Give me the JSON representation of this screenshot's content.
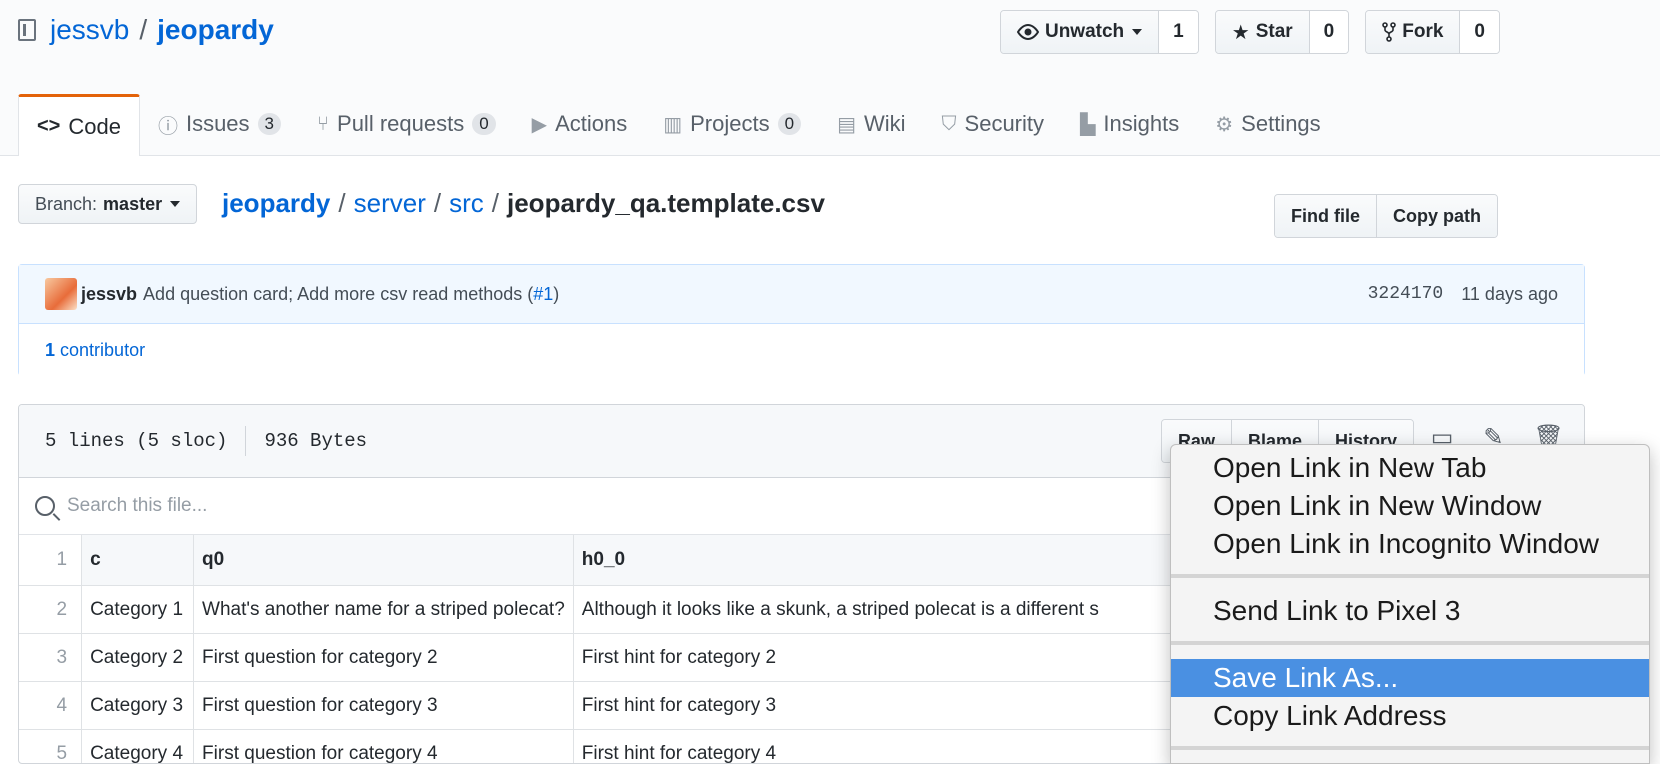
{
  "repo": {
    "owner": "jessvb",
    "separator": "/",
    "name": "jeopardy"
  },
  "actions": {
    "unwatch": {
      "label": "Unwatch",
      "count": "1"
    },
    "star": {
      "label": "Star",
      "count": "0"
    },
    "fork": {
      "label": "Fork",
      "count": "0"
    }
  },
  "tabs": [
    {
      "label": "Code",
      "icon": "<>"
    },
    {
      "label": "Issues",
      "count": "3"
    },
    {
      "label": "Pull requests",
      "count": "0"
    },
    {
      "label": "Actions"
    },
    {
      "label": "Projects",
      "count": "0"
    },
    {
      "label": "Wiki"
    },
    {
      "label": "Security"
    },
    {
      "label": "Insights"
    },
    {
      "label": "Settings"
    }
  ],
  "branch": {
    "label": "Branch:",
    "value": "master"
  },
  "breadcrumb": {
    "parts": [
      "jeopardy",
      "server",
      "src"
    ],
    "file": "jeopardy_qa.template.csv",
    "sep": "/"
  },
  "file_nav": {
    "find_file": "Find file",
    "copy_path": "Copy path"
  },
  "commit": {
    "author": "jessvb",
    "message": "Add question card; Add more csv read methods (",
    "issue_link": "#1",
    "message_end": ")",
    "sha": "3224170",
    "time": "11 days ago",
    "contributors_count": "1",
    "contributors_label": "contributor"
  },
  "file": {
    "lines": "5 lines (5 sloc)",
    "size": "936 Bytes",
    "raw": "Raw",
    "blame": "Blame",
    "history": "History",
    "search_placeholder": "Search this file..."
  },
  "table": {
    "header": [
      "c",
      "q0",
      "h0_0"
    ],
    "rows": [
      {
        "ln": "1"
      },
      {
        "ln": "2",
        "cells": [
          "Category 1",
          "What's another name for a striped polecat?",
          "Although it looks like a skunk, a striped polecat is a different s"
        ]
      },
      {
        "ln": "3",
        "cells": [
          "Category 2",
          "First question for category 2",
          "First hint for category 2"
        ]
      },
      {
        "ln": "4",
        "cells": [
          "Category 3",
          "First question for category 3",
          "First hint for category 3"
        ]
      },
      {
        "ln": "5",
        "cells": [
          "Category 4",
          "First question for category 4",
          "First hint for category 4"
        ]
      }
    ]
  },
  "context_menu": {
    "group1": [
      "Open Link in New Tab",
      "Open Link in New Window",
      "Open Link in Incognito Window"
    ],
    "group2": [
      "Send Link to Pixel 3"
    ],
    "group3": [
      "Save Link As...",
      "Copy Link Address"
    ]
  },
  "colors": {
    "link": "#0366d6",
    "tab_accent": "#e36209",
    "menu_highlight": "#4a90e2"
  }
}
